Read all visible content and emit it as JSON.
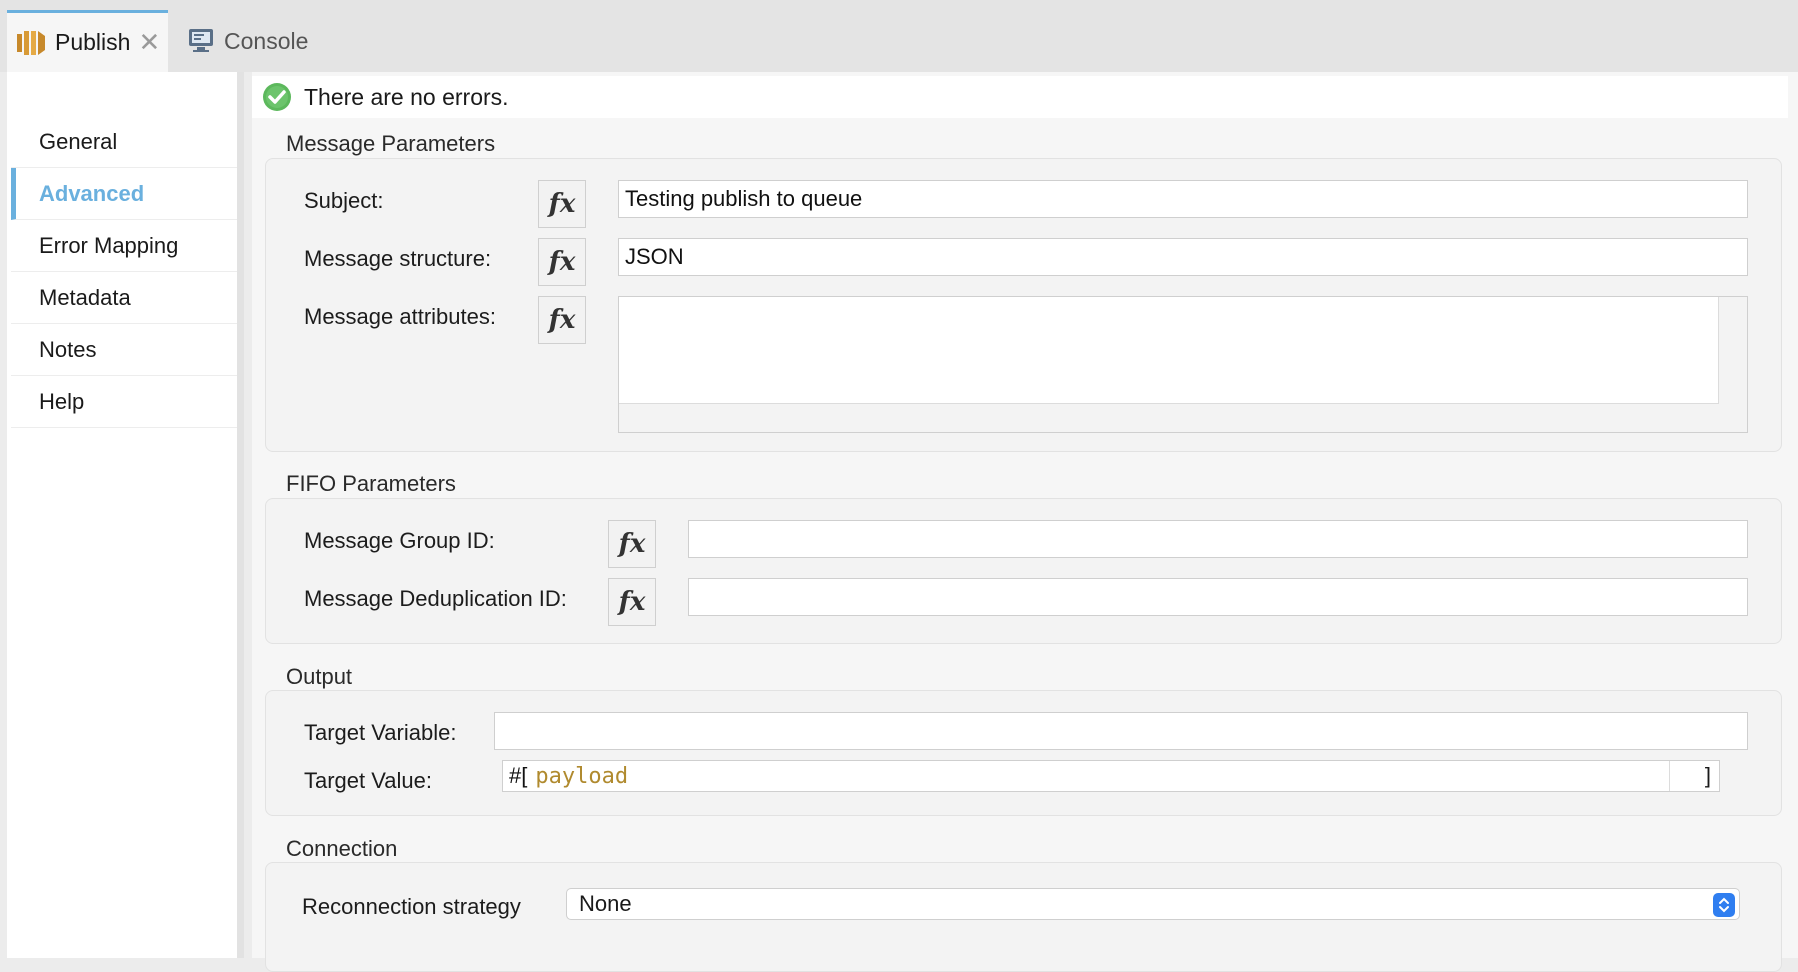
{
  "tabs": [
    {
      "label": "Publish",
      "icon": "publish-connector-icon",
      "active": true
    },
    {
      "label": "Console",
      "icon": "console-icon",
      "active": false
    }
  ],
  "nav": {
    "items": [
      {
        "label": "General"
      },
      {
        "label": "Advanced"
      },
      {
        "label": "Error Mapping"
      },
      {
        "label": "Metadata"
      },
      {
        "label": "Notes"
      },
      {
        "label": "Help"
      }
    ],
    "active": "Advanced"
  },
  "status": {
    "text": "There are no errors.",
    "icon": "success-check-icon"
  },
  "message_parameters": {
    "title": "Message Parameters",
    "subject_label": "Subject:",
    "subject_value": "Testing publish to queue",
    "structure_label": "Message structure:",
    "structure_value": "JSON",
    "attributes_label": "Message attributes:",
    "attributes_value": ""
  },
  "fifo_parameters": {
    "title": "FIFO Parameters",
    "group_id_label": "Message Group ID:",
    "group_id_value": "",
    "dedup_id_label": "Message Deduplication ID:",
    "dedup_id_value": ""
  },
  "output": {
    "title": "Output",
    "target_variable_label": "Target Variable:",
    "target_variable_value": "",
    "target_value_label": "Target Value:",
    "expr_open": "#[",
    "expr_code": "payload",
    "expr_close": "]"
  },
  "connection": {
    "title": "Connection",
    "reconnection_label": "Reconnection strategy",
    "reconnection_value": "None"
  },
  "fx_symbol": "fx",
  "colors": {
    "accent": "#6ab0de",
    "success": "#5cb85c",
    "code": "#b08a2e",
    "select": "#2f7ef0"
  }
}
